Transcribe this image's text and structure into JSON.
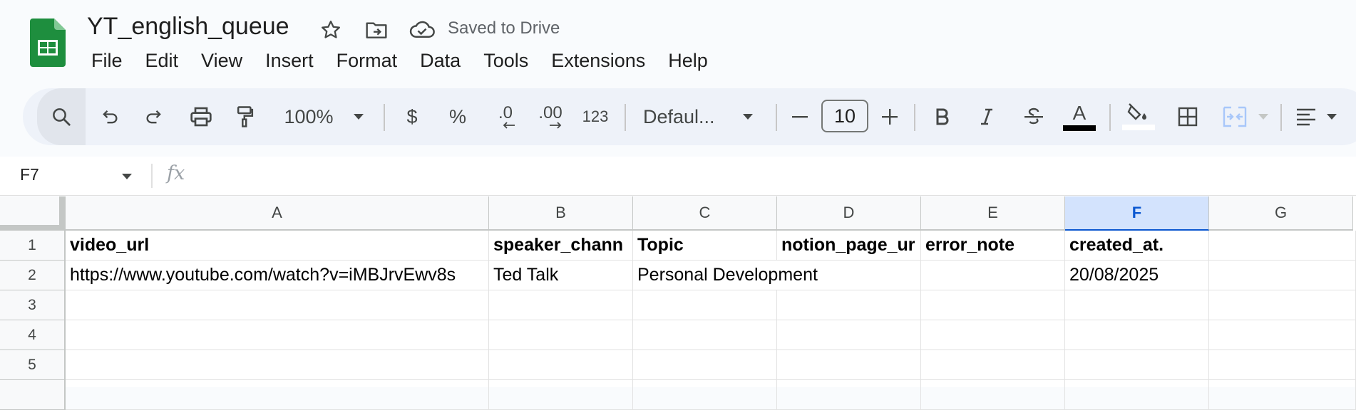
{
  "app": {
    "doc_title": "YT_english_queue",
    "saved_status": "Saved to Drive"
  },
  "menu": [
    "File",
    "Edit",
    "View",
    "Insert",
    "Format",
    "Data",
    "Tools",
    "Extensions",
    "Help"
  ],
  "toolbar": {
    "zoom": "100%",
    "currency": "$",
    "percent": "%",
    "decrease_decimal": ".0",
    "increase_decimal": ".00",
    "number_format": "123",
    "font": "Defaul...",
    "font_size": "10",
    "text_color_icon": "A"
  },
  "formula_bar": {
    "cell_ref": "F7",
    "fx_label": "fx",
    "value": ""
  },
  "columns": [
    "A",
    "B",
    "C",
    "D",
    "E",
    "F",
    "G"
  ],
  "selected_column": "F",
  "rows": [
    "1",
    "2",
    "3",
    "4",
    "5"
  ],
  "cells": {
    "r1": [
      "video_url",
      "speaker_chann",
      "Topic",
      "notion_page_ur",
      "error_note",
      "created_at.",
      ""
    ],
    "r2": [
      "https://www.youtube.com/watch?v=iMBJrvEwv8s",
      "Ted Talk",
      "Personal Development",
      "",
      "",
      "20/08/2025",
      ""
    ]
  },
  "colors": {
    "selected_header": "#d3e3fd",
    "accent": "#0b57d0",
    "sheets_green": "#0f9d58"
  }
}
